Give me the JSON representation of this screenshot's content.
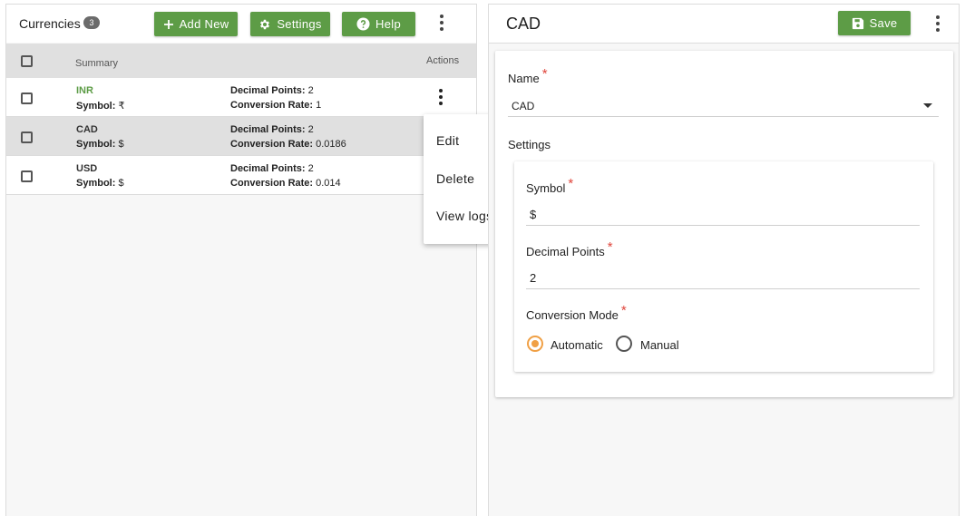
{
  "colors": {
    "accent": "#5d9c46",
    "radio_active": "#f0a045",
    "required": "#e0463c"
  },
  "list": {
    "title": "Currencies",
    "count": "3",
    "buttons": {
      "add_new": "Add New",
      "settings": "Settings",
      "help": "Help"
    },
    "columns": {
      "summary": "Summary",
      "actions": "Actions"
    },
    "rows": [
      {
        "name": "INR",
        "symbol_label": "Symbol:",
        "symbol": " ₹",
        "dp_label": "Decimal Points:",
        "dp": " 2",
        "cr_label": "Conversion Rate:",
        "cr": " 1"
      },
      {
        "name": "CAD",
        "symbol_label": "Symbol:",
        "symbol": " $",
        "dp_label": "Decimal Points:",
        "dp": " 2",
        "cr_label": "Conversion Rate:",
        "cr": " 0.0186"
      },
      {
        "name": "USD",
        "symbol_label": "Symbol:",
        "symbol": " $",
        "dp_label": "Decimal Points:",
        "dp": " 2",
        "cr_label": "Conversion Rate:",
        "cr": " 0.014"
      }
    ],
    "context_menu": [
      "Edit",
      "Delete",
      "View logs"
    ]
  },
  "detail": {
    "title": "CAD",
    "save_label": "Save",
    "name_label": "Name",
    "name_value": "CAD",
    "settings_label": "Settings",
    "symbol_label": "Symbol",
    "symbol_value": "$",
    "decimal_label": "Decimal Points",
    "decimal_value": "2",
    "mode_label": "Conversion Mode",
    "mode_options": [
      "Automatic",
      "Manual"
    ],
    "mode_selected": "Automatic",
    "required_mark": "*"
  }
}
